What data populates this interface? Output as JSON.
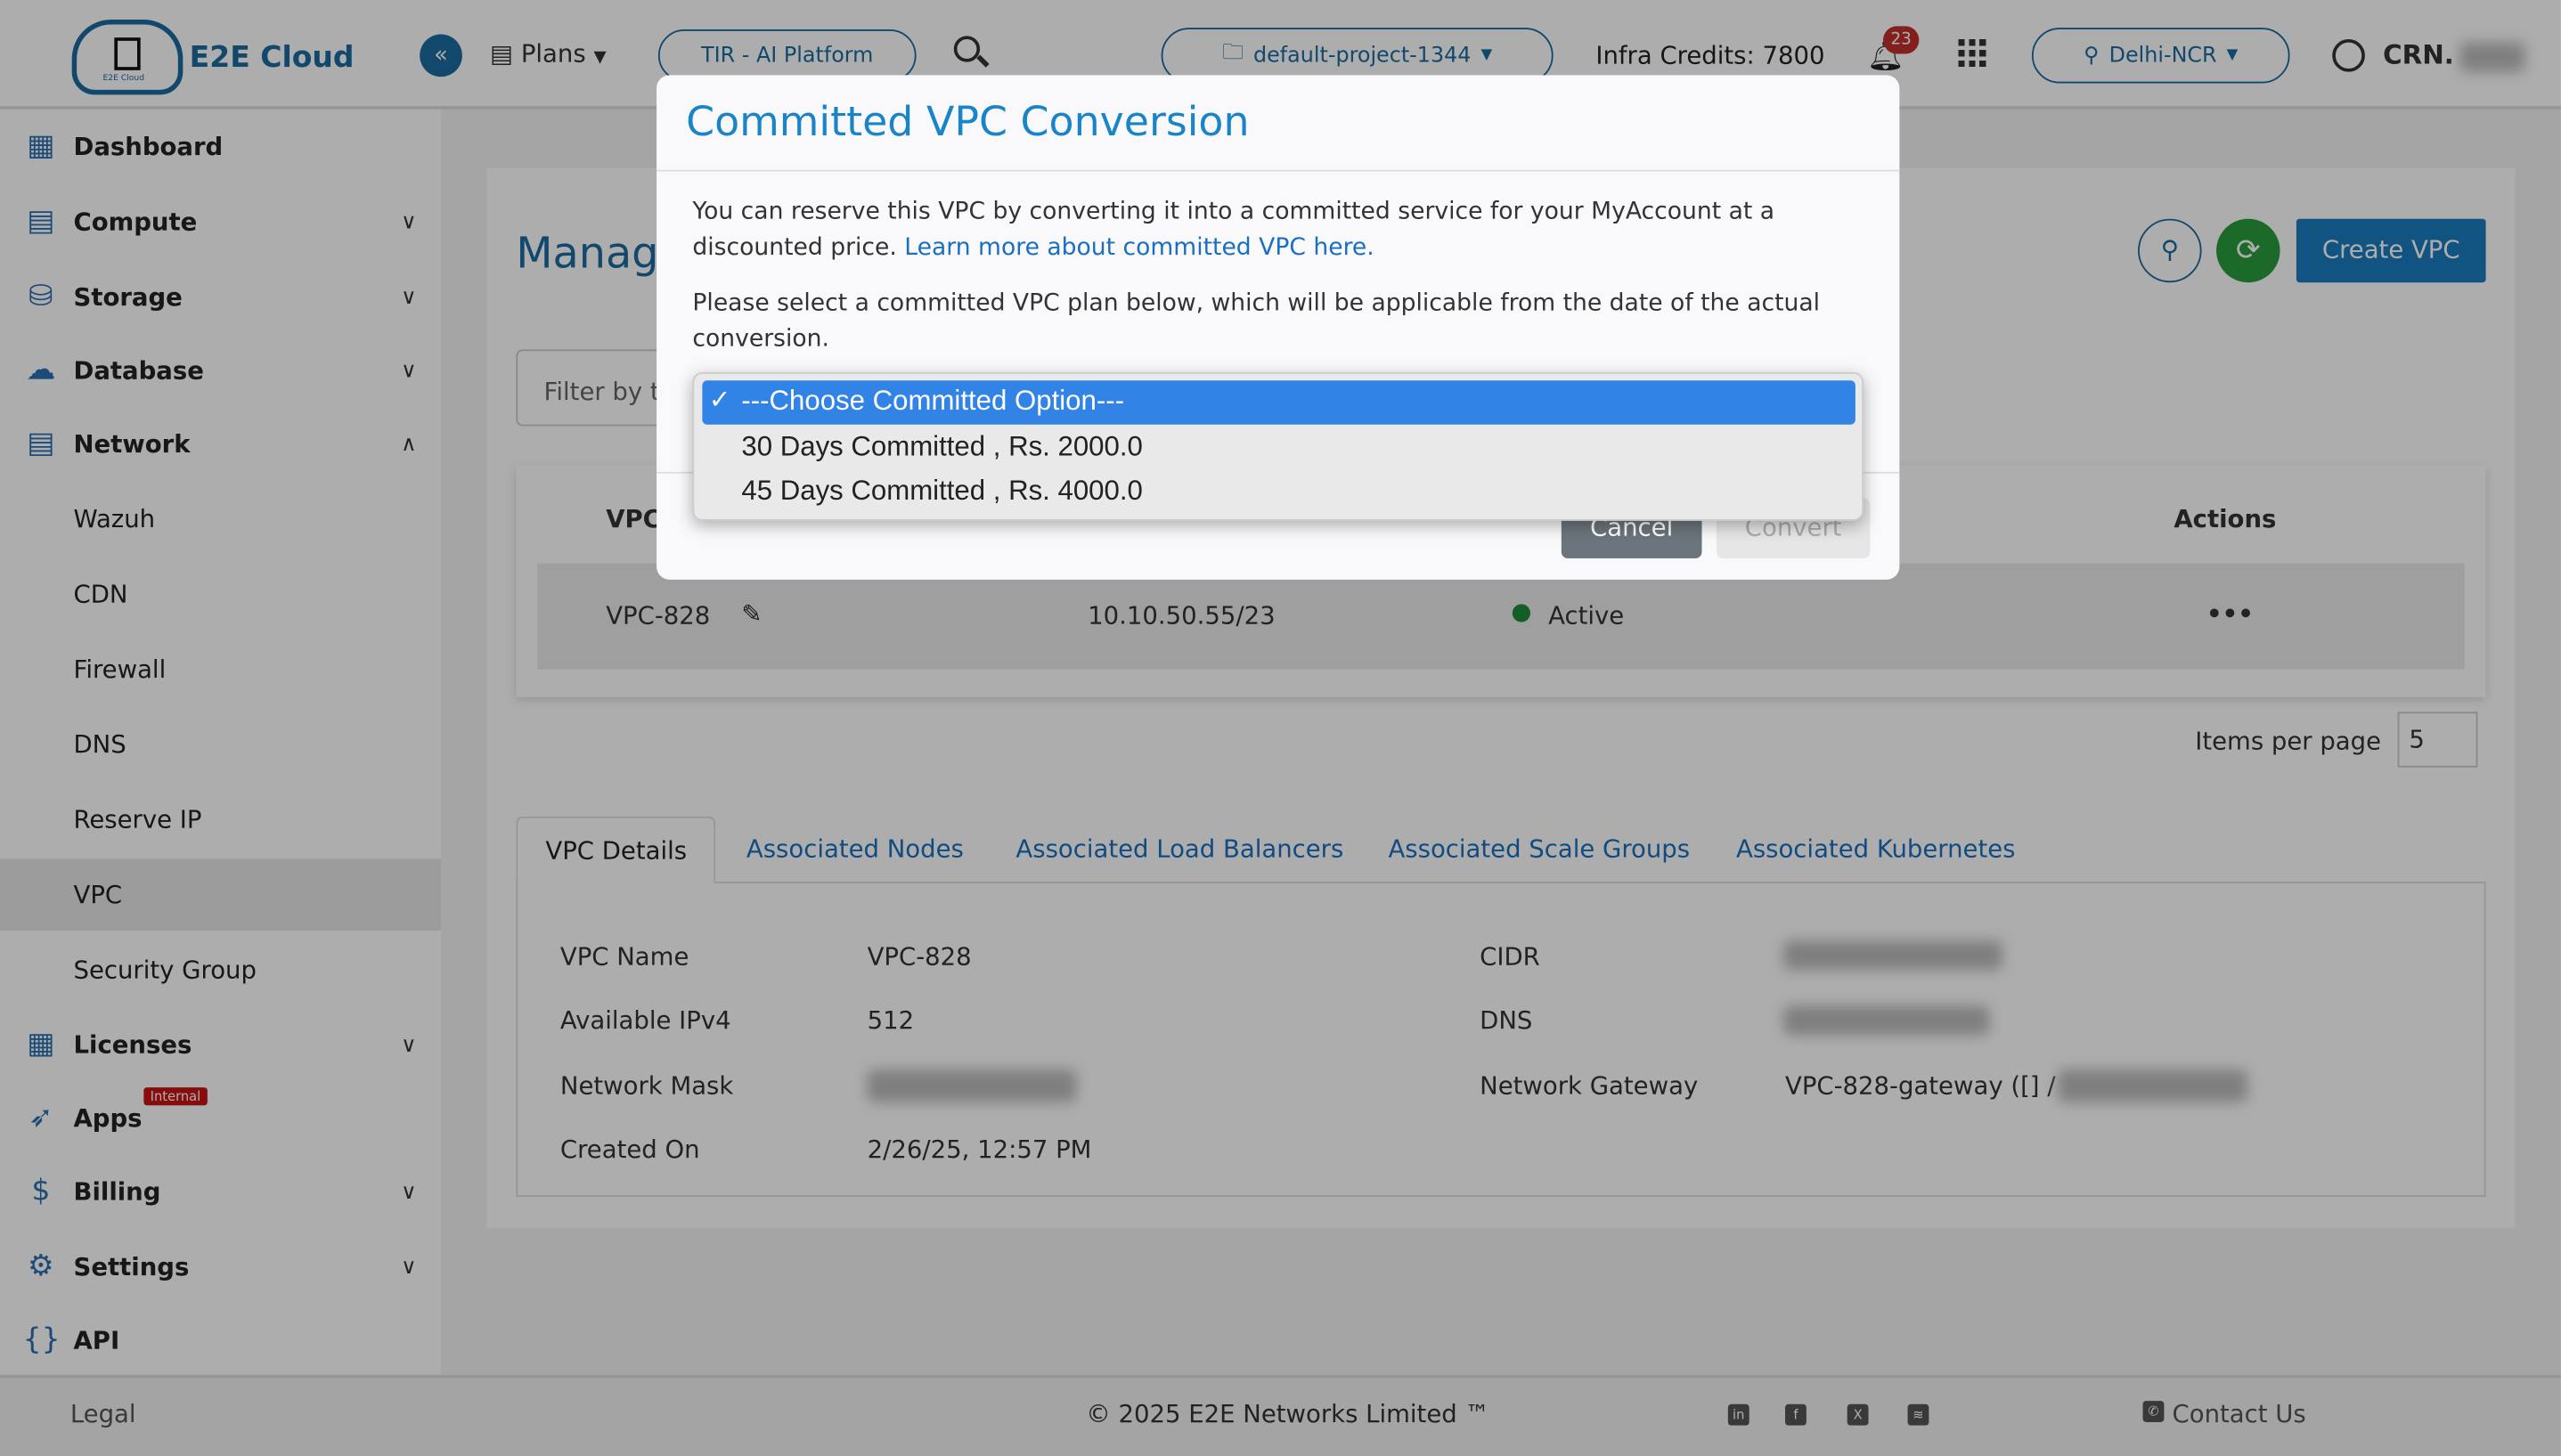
{
  "header": {
    "brand": "E2E Cloud",
    "logo_caption": "E2E Cloud",
    "plans": "Plans",
    "tir": "TIR - AI Platform",
    "project": "default-project-1344",
    "credits": "Infra Credits: 7800",
    "notifications": "23",
    "region": "Delhi-NCR",
    "crn": "CRN."
  },
  "sidebar": {
    "items": [
      {
        "label": "Dashboard"
      },
      {
        "label": "Compute"
      },
      {
        "label": "Storage"
      },
      {
        "label": "Database"
      },
      {
        "label": "Network"
      },
      {
        "label": "Wazuh"
      },
      {
        "label": "CDN"
      },
      {
        "label": "Firewall"
      },
      {
        "label": "DNS"
      },
      {
        "label": "Reserve IP"
      },
      {
        "label": "VPC"
      },
      {
        "label": "Security Group"
      },
      {
        "label": "Licenses"
      },
      {
        "label": "Apps",
        "badge": "Internal"
      },
      {
        "label": "Billing"
      },
      {
        "label": "Settings"
      },
      {
        "label": "API"
      }
    ]
  },
  "main": {
    "title": "Manage",
    "filter_placeholder": "Filter by t",
    "create_button": "Create VPC",
    "table": {
      "col_vpc": "VPC",
      "col_actions": "Actions",
      "row": {
        "name": "VPC-828",
        "cidr": "10.10.50.55/23",
        "status": "Active",
        "actions": "•••"
      }
    },
    "items_per_page_label": "Items per page",
    "items_per_page": "5",
    "tabs": [
      "VPC Details",
      "Associated Nodes",
      "Associated Load Balancers",
      "Associated Scale Groups",
      "Associated Kubernetes"
    ],
    "details": {
      "vpc_name_label": "VPC Name",
      "vpc_name": "VPC-828",
      "ipv4_label": "Available IPv4",
      "ipv4": "512",
      "mask_label": "Network Mask",
      "created_label": "Created On",
      "created": "2/26/25, 12:57 PM",
      "cidr_label": "CIDR",
      "dns_label": "DNS",
      "gateway_label": "Network Gateway",
      "gateway": "VPC-828-gateway ([] /"
    }
  },
  "modal": {
    "title": "Committed VPC Conversion",
    "p1": "You can reserve this VPC by converting it into a committed service for your MyAccount at a discounted price.",
    "p1_link": "Learn more about committed VPC here.",
    "p2": "Please select a committed VPC plan below, which will be applicable from the date of the actual conversion.",
    "options": [
      "---Choose Committed Option---",
      "30 Days Committed , Rs. 2000.0",
      "45 Days Committed , Rs. 4000.0"
    ],
    "selected_index": 0,
    "cancel": "Cancel",
    "convert": "Convert"
  },
  "footer": {
    "legal": "Legal",
    "copyright": "© 2025 E2E Networks Limited ™",
    "contact": "Contact Us",
    "social": [
      "linkedin",
      "facebook",
      "x",
      "rss"
    ]
  },
  "colors": {
    "brand": "#1a6aa0",
    "accent": "#1a7bbf",
    "selected_option": "#3283e6",
    "status_active": "#1f8a3a",
    "refresh": "#2a9d3f"
  }
}
